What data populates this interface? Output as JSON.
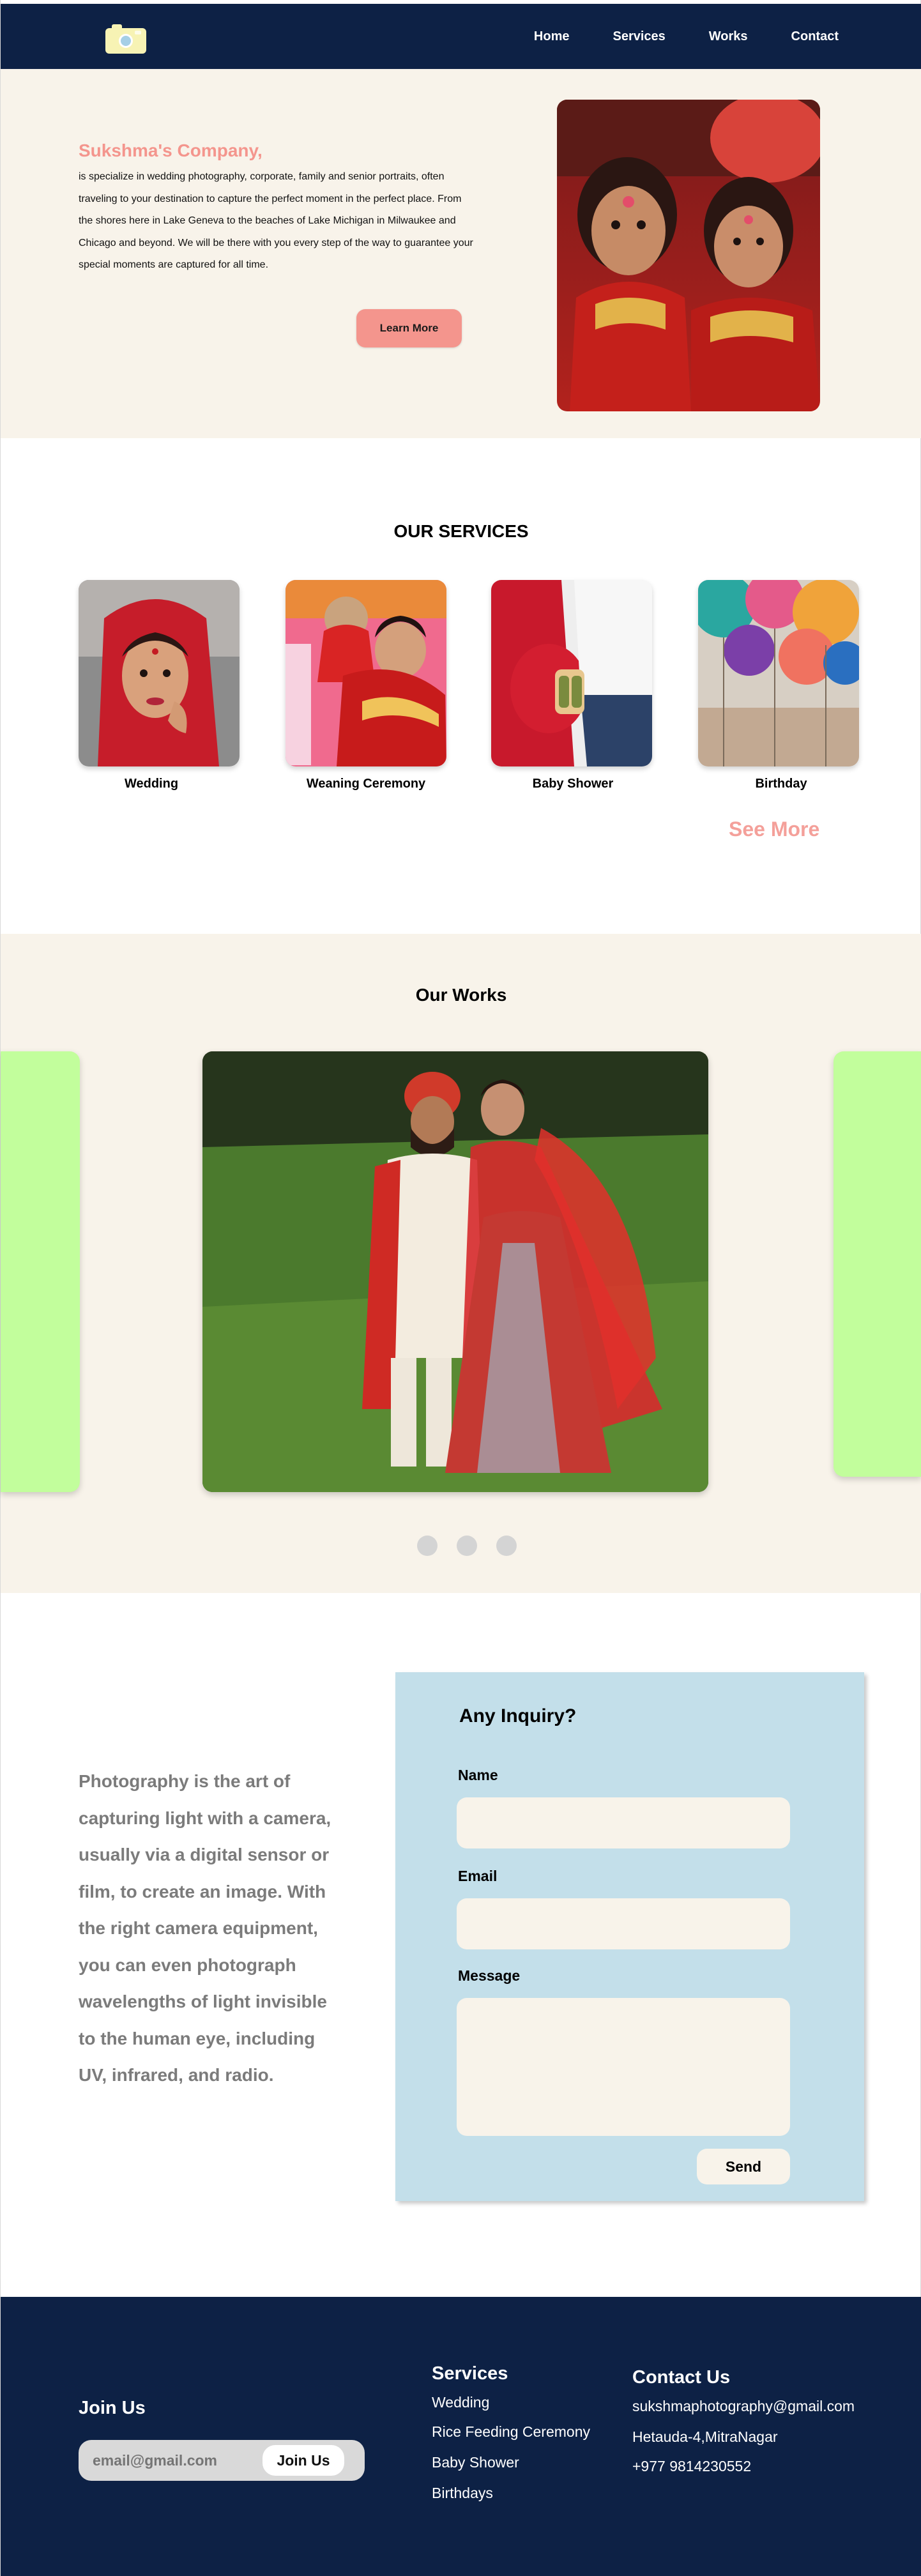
{
  "nav": {
    "logo_icon": "camera-icon",
    "links": [
      "Home",
      "Services",
      "Works",
      "Contact"
    ]
  },
  "hero": {
    "title": "Sukshma's Company,",
    "description": " is specialize in wedding photography, corporate, family and senior portraits, often traveling to your destination to capture the perfect moment in the perfect place. From the shores here in Lake Geneva to the beaches of Lake Michigan in Milwaukee and Chicago and beyond. We will be there with you every step of the way to guarantee your special moments are captured for all time.",
    "button": "Learn More"
  },
  "services": {
    "title": "OUR SERVICES",
    "items": [
      "Wedding",
      "Weaning Ceremony",
      "Baby Shower",
      "Birthday"
    ],
    "see_more": "See More"
  },
  "works": {
    "title": "Our Works",
    "dot_count": 3
  },
  "inquiry": {
    "quote": "Photography is the art of capturing light with a camera, usually via a digital sensor or film, to create an image. With the right camera equipment, you can even photograph wavelengths of light invisible to the human eye, including UV, infrared, and radio.",
    "title": "Any Inquiry?",
    "name_label": "Name",
    "email_label": "Email",
    "message_label": "Message",
    "name_value": "",
    "email_value": "",
    "message_value": "",
    "send": "Send"
  },
  "footer": {
    "join_title": "Join Us",
    "join_placeholder": "email@gmail.com",
    "join_button": "Join Us",
    "services_title": "Services",
    "services": [
      "Wedding",
      "Rice Feeding Ceremony",
      "Baby Shower",
      "Birthdays"
    ],
    "contact_title": "Contact Us",
    "contact": [
      "sukshmaphotography@gmail.com",
      "Hetauda-4,MitraNagar",
      "+977 9814230552"
    ]
  },
  "colors": {
    "navy": "#0d2145",
    "cream": "#f8f3ea",
    "salmon": "#f4958d",
    "lime": "#c2fe9c",
    "light_blue": "#c3dfea"
  }
}
